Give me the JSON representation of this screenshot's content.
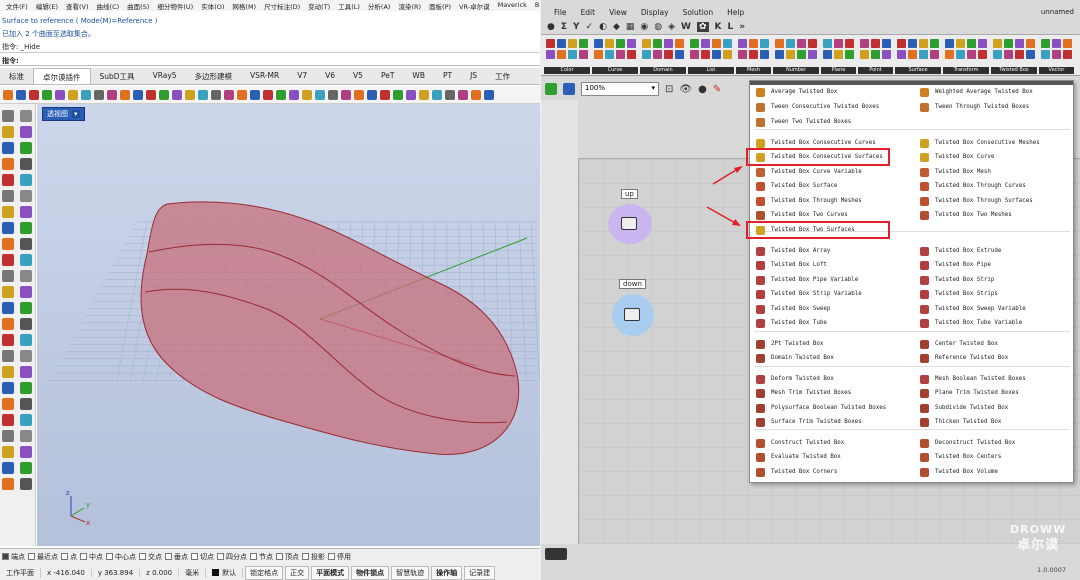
{
  "rhino": {
    "menu": [
      "文件(F)",
      "编辑(E)",
      "查看(V)",
      "曲线(C)",
      "曲面(S)",
      "细分物件(U)",
      "实体(O)",
      "网格(M)",
      "尺寸标注(D)",
      "变动(T)",
      "工具(L)",
      "分析(A)",
      "渲染(R)",
      "面板(P)",
      "VR-卓尔谟",
      "Maverick",
      "Bl"
    ],
    "history": [
      "Surface to reference ( Mode(M)=Reference )",
      "已加入 2 个曲面至选取集合。",
      "指令: _Hide"
    ],
    "prompt": "指令:",
    "tabs": [
      "标准",
      "卓尔谟插件",
      "SubD工具",
      "VRay5",
      "多边形建模",
      "VSR-MR",
      "V7",
      "V6",
      "V5",
      "PeT",
      "WB",
      "PT",
      "JS",
      "工作"
    ],
    "active_tab": "卓尔谟插件",
    "viewport_label": "透视图",
    "axis": {
      "x": "x",
      "y": "y",
      "z": "z"
    },
    "osnaps": [
      {
        "label": "端点",
        "on": true
      },
      {
        "label": "最近点",
        "on": false
      },
      {
        "label": "点",
        "on": false
      },
      {
        "label": "中点",
        "on": false
      },
      {
        "label": "中心点",
        "on": false
      },
      {
        "label": "交点",
        "on": false
      },
      {
        "label": "垂点",
        "on": false
      },
      {
        "label": "切点",
        "on": false
      },
      {
        "label": "四分点",
        "on": false
      },
      {
        "label": "节点",
        "on": false
      },
      {
        "label": "顶点",
        "on": false
      },
      {
        "label": "投影",
        "on": false
      },
      {
        "label": "停用",
        "on": false
      }
    ],
    "status": {
      "plane": "工作平面",
      "x": "x -416.040",
      "y": "y 363.894",
      "z": "z 0.000",
      "unit": "毫米",
      "layer": "默认"
    },
    "status_buttons": [
      "锁定格点",
      "正交",
      "平面模式",
      "物件锁点",
      "智慧轨迹",
      "操作轴",
      "记录建"
    ],
    "status_bold": [
      "平面模式",
      "物件锁点",
      "操作轴"
    ]
  },
  "grasshopper": {
    "menu": [
      "File",
      "Edit",
      "View",
      "Display",
      "Solution",
      "Help"
    ],
    "title": "unnamed",
    "zoom": "100%",
    "ribbon_groups": [
      "Color",
      "Curve",
      "Domain",
      "List",
      "Mesh",
      "Number",
      "Plane",
      "Point",
      "Surface",
      "Transform",
      "Twisted Box",
      "Vector"
    ],
    "nodes": {
      "up": "up",
      "down": "down"
    },
    "version": "1.0.0007"
  },
  "dropdown": {
    "left": [
      "Average Twisted Box",
      "Tween Consecutive Twisted Boxes",
      "Tween Two Twisted Boxes",
      "Twisted Box Consecutive Curves",
      "Twisted Box Consecutive Surfaces",
      "Twisted Box Curve Variable",
      "Twisted Box Surface",
      "Twisted Box Through Meshes",
      "Twisted Box Two Curves",
      "Twisted Box Two Surfaces",
      "Twisted Box Array",
      "Twisted Box Loft",
      "Twisted Box Pipe Variable",
      "Twisted Box Strip Variable",
      "Twisted Box Sweep",
      "Twisted Box Tube",
      "2Pt Twisted Box",
      "Domain Twisted Box",
      "Deform Twisted Box",
      "Mesh Trim Twisted Boxes",
      "Polysurface Boolean Twisted Boxes",
      "Surface Trim Twisted Boxes",
      "Construct Twisted Box",
      "Evaluate Twisted Box",
      "Twisted Box Corners"
    ],
    "right": [
      "Weighted Average Twisted Box",
      "Tween Through Twisted Boxes",
      "",
      "Twisted Box Consecutive Meshes",
      "Twisted Box Curve",
      "Twisted Box Mesh",
      "Twisted Box Through Curves",
      "Twisted Box Through Surfaces",
      "Twisted Box Two Meshes",
      "",
      "Twisted Box Extrude",
      "Twisted Box Pipe",
      "Twisted Box Strip",
      "Twisted Box Strips",
      "Twisted Box Sweep Variable",
      "Twisted Box Tube Variable",
      "Center Twisted Box",
      "Reference Twisted Box",
      "Mesh Boolean Twisted Boxes",
      "Plane Trim Twisted Boxes",
      "Subdivide Twisted Box",
      "Thicken Twisted Box",
      "Deconstruct Twisted Box",
      "Twisted Box Centers",
      "Twisted Box Volume"
    ],
    "highlighted": [
      "Twisted Box Consecutive Surfaces",
      "Twisted Box Two Surfaces"
    ]
  },
  "watermark": {
    "line1": "DROWW",
    "line2": "卓尔谟"
  },
  "colors": {
    "accent": "#e0202a",
    "surface": "#c96d78",
    "node_up": "#c9b6f0",
    "node_down": "#a8cdf0"
  }
}
